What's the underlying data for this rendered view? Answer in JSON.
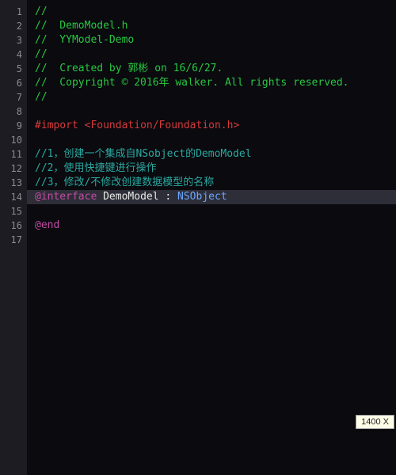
{
  "editor": {
    "line_count": 17,
    "highlighted_line": 14,
    "lines": [
      {
        "segments": [
          {
            "cls": "c-comment",
            "text": "//"
          }
        ]
      },
      {
        "segments": [
          {
            "cls": "c-comment",
            "text": "//  DemoModel.h"
          }
        ]
      },
      {
        "segments": [
          {
            "cls": "c-comment",
            "text": "//  YYModel-Demo"
          }
        ]
      },
      {
        "segments": [
          {
            "cls": "c-comment",
            "text": "//"
          }
        ]
      },
      {
        "segments": [
          {
            "cls": "c-comment",
            "text": "//  Created by 郭彬 on 16/6/27."
          }
        ]
      },
      {
        "segments": [
          {
            "cls": "c-comment",
            "text": "//  Copyright © 2016年 walker. All rights reserved."
          }
        ]
      },
      {
        "segments": [
          {
            "cls": "c-comment",
            "text": "//"
          }
        ]
      },
      {
        "segments": []
      },
      {
        "segments": [
          {
            "cls": "c-preproc",
            "text": "#import "
          },
          {
            "cls": "c-header",
            "text": "<Foundation/Foundation.h>"
          }
        ]
      },
      {
        "segments": []
      },
      {
        "segments": [
          {
            "cls": "c-comment2",
            "text": "//1，创建一个集成自NSobject的DemoModel"
          }
        ]
      },
      {
        "segments": [
          {
            "cls": "c-comment2",
            "text": "//2，使用快捷键进行操作"
          }
        ]
      },
      {
        "segments": [
          {
            "cls": "c-comment2",
            "text": "//3，修改/不修改创建数据模型的名称"
          }
        ]
      },
      {
        "segments": [
          {
            "cls": "c-keyword",
            "text": "@interface"
          },
          {
            "cls": "c-class",
            "text": " DemoModel "
          },
          {
            "cls": "c-colon",
            "text": ": "
          },
          {
            "cls": "c-type",
            "text": "NSObject"
          }
        ]
      },
      {
        "segments": []
      },
      {
        "segments": [
          {
            "cls": "c-keyword",
            "text": "@end"
          }
        ]
      },
      {
        "segments": []
      }
    ]
  },
  "tooltip": {
    "text": "1400 X"
  }
}
